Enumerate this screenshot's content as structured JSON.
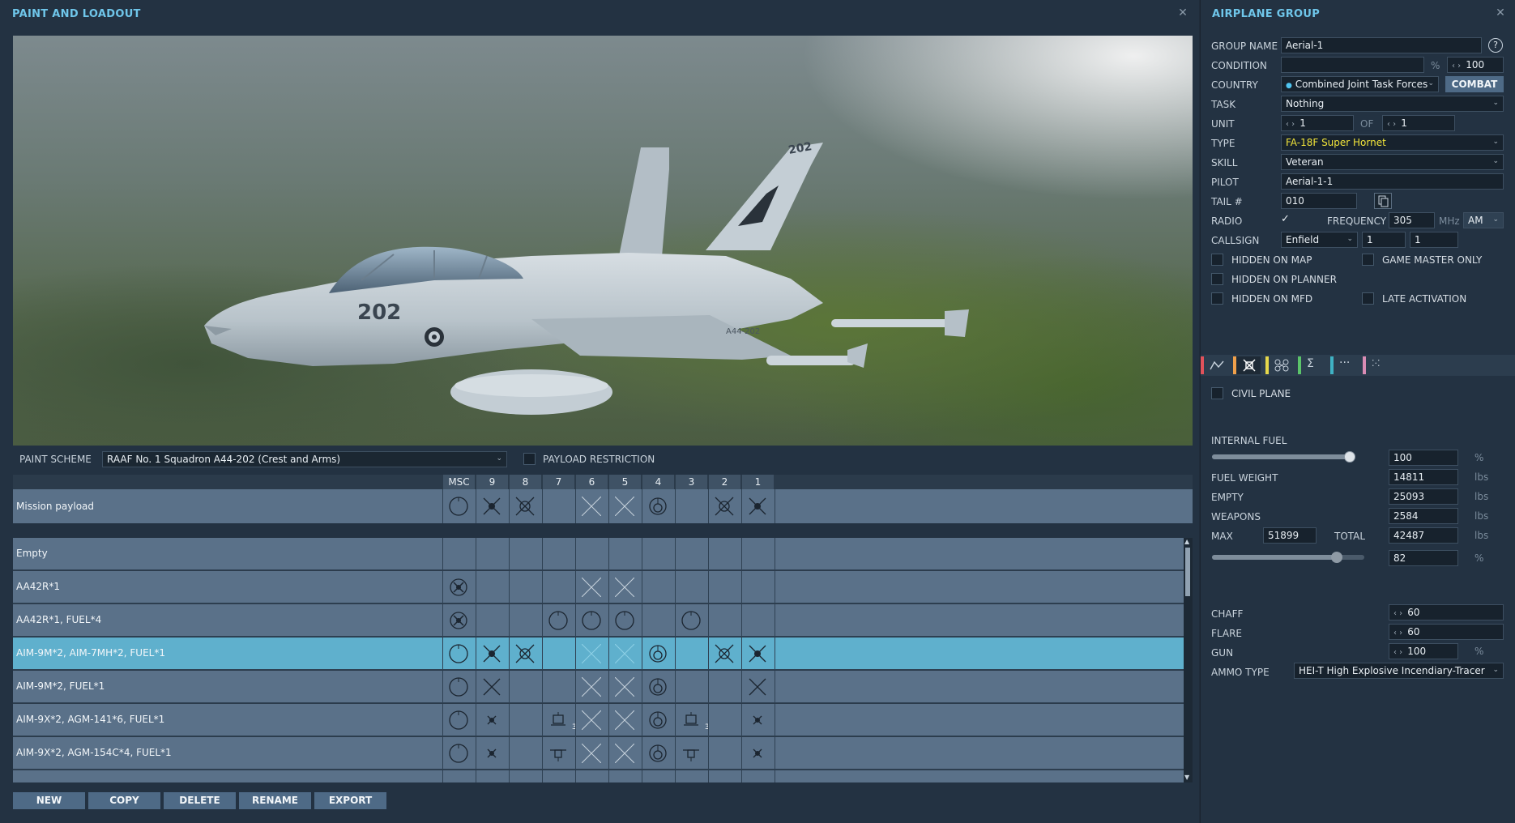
{
  "left_panel": {
    "title": "PAINT AND LOADOUT",
    "paint_scheme_label": "PAINT SCHEME",
    "paint_scheme_value": "RAAF No. 1 Squadron A44-202 (Crest and Arms)",
    "payload_restriction_label": "PAYLOAD RESTRICTION",
    "aircraft_marking": "202",
    "tail_marking": "202",
    "fuselage_serial": "A44-202",
    "station_headers": [
      "MSC",
      "9",
      "8",
      "7",
      "6",
      "5",
      "4",
      "3",
      "2",
      "1"
    ],
    "mission_payload_label": "Mission payload",
    "loadouts": [
      {
        "name": "Empty"
      },
      {
        "name": "AA42R*1"
      },
      {
        "name": "AA42R*1, FUEL*4"
      },
      {
        "name": "AIM-9M*2, AIM-7MH*2, FUEL*1",
        "selected": true
      },
      {
        "name": "AIM-9M*2, FUEL*1"
      },
      {
        "name": "AIM-9X*2, AGM-141*6, FUEL*1"
      },
      {
        "name": "AIM-9X*2, AGM-154C*4, FUEL*1"
      }
    ],
    "station_counts": {
      "agm141_a": "3",
      "agm141_b": "3"
    },
    "buttons": {
      "new": "NEW",
      "copy": "COPY",
      "delete": "DELETE",
      "rename": "RENAME",
      "export": "EXPORT"
    }
  },
  "right_panel": {
    "title": "AIRPLANE GROUP",
    "help": "?",
    "group_name_label": "GROUP NAME",
    "group_name_value": "Aerial-1",
    "condition_label": "CONDITION",
    "condition_unit": "%",
    "condition_value": "100",
    "country_label": "COUNTRY",
    "country_value": "Combined Joint Task Forces",
    "combat_button": "COMBAT",
    "task_label": "TASK",
    "task_value": "Nothing",
    "unit_label": "UNIT",
    "unit_value": "1",
    "unit_of_label": "OF",
    "unit_of_value": "1",
    "type_label": "TYPE",
    "type_value": "FA-18F Super Hornet",
    "skill_label": "SKILL",
    "skill_value": "Veteran",
    "pilot_label": "PILOT",
    "pilot_value": "Aerial-1-1",
    "tail_label": "TAIL #",
    "tail_value": "010",
    "radio_label": "RADIO",
    "radio_checked": true,
    "frequency_label": "FREQUENCY",
    "frequency_value": "305",
    "frequency_unit": "MHz",
    "modulation_value": "AM",
    "callsign_label": "CALLSIGN",
    "callsign_value": "Enfield",
    "callsign_num1": "1",
    "callsign_num2": "1",
    "checkboxes": {
      "hidden_on_map": "HIDDEN ON MAP",
      "game_master_only": "GAME MASTER ONLY",
      "hidden_on_planner": "HIDDEN ON PLANNER",
      "hidden_on_mfd": "HIDDEN ON MFD",
      "late_activation": "LATE ACTIVATION",
      "civil_plane": "CIVIL PLANE"
    },
    "tab_colors": [
      "#e0525b",
      "#f0a04b",
      "#e6d84b",
      "#5bc46a",
      "#3fb2c4",
      "#d98cb4"
    ],
    "tab_icons": [
      "route-icon",
      "payload-icon",
      "waypoint-icon",
      "summary-icon",
      "more-icon",
      "triggers-icon"
    ],
    "internal_fuel_label": "INTERNAL FUEL",
    "internal_fuel_value": "100",
    "internal_fuel_level": 1.0,
    "percent_unit": "%",
    "fuel_weight_label": "FUEL WEIGHT",
    "fuel_weight_value": "14811",
    "empty_label": "EMPTY",
    "empty_value": "25093",
    "weapons_label": "WEAPONS",
    "weapons_value": "2584",
    "max_label": "MAX",
    "max_value": "51899",
    "total_label": "TOTAL",
    "total_value": "42487",
    "lbs_unit": "lbs",
    "weight_percent_value": "82",
    "weight_percent_level": 0.82,
    "chaff_label": "CHAFF",
    "chaff_value": "60",
    "flare_label": "FLARE",
    "flare_value": "60",
    "gun_label": "GUN",
    "gun_value": "100",
    "ammo_type_label": "AMMO TYPE",
    "ammo_type_value": "HEI-T High Explosive Incendiary-Tracer"
  }
}
